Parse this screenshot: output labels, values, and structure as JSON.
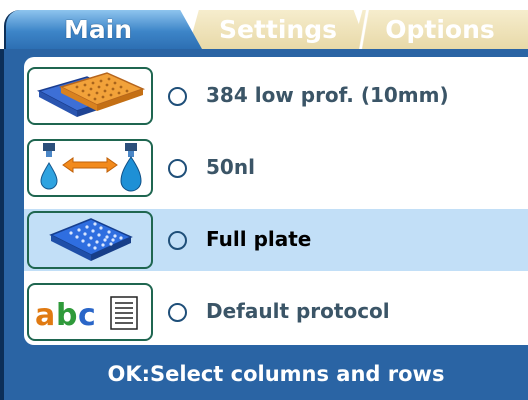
{
  "tabs": [
    {
      "label": "Main",
      "active": true
    },
    {
      "label": "Settings",
      "active": false
    },
    {
      "label": "Options",
      "active": false
    }
  ],
  "rows": [
    {
      "icon": "plate-384-icon",
      "label": "384 low prof. (10mm)",
      "selected": false
    },
    {
      "icon": "dispense-volume-icon",
      "label": "50nl",
      "selected": false
    },
    {
      "icon": "plate-full-icon",
      "label": "Full plate",
      "selected": true
    },
    {
      "icon": "protocol-abc-icon",
      "label": "Default protocol",
      "selected": false
    }
  ],
  "status": {
    "text": "OK:Select columns and rows"
  },
  "colors": {
    "accent": "#2a64a4",
    "selected_row": "#c2dff7",
    "inactive_tab": "#efe3bc",
    "icon_border": "#1f6650"
  }
}
